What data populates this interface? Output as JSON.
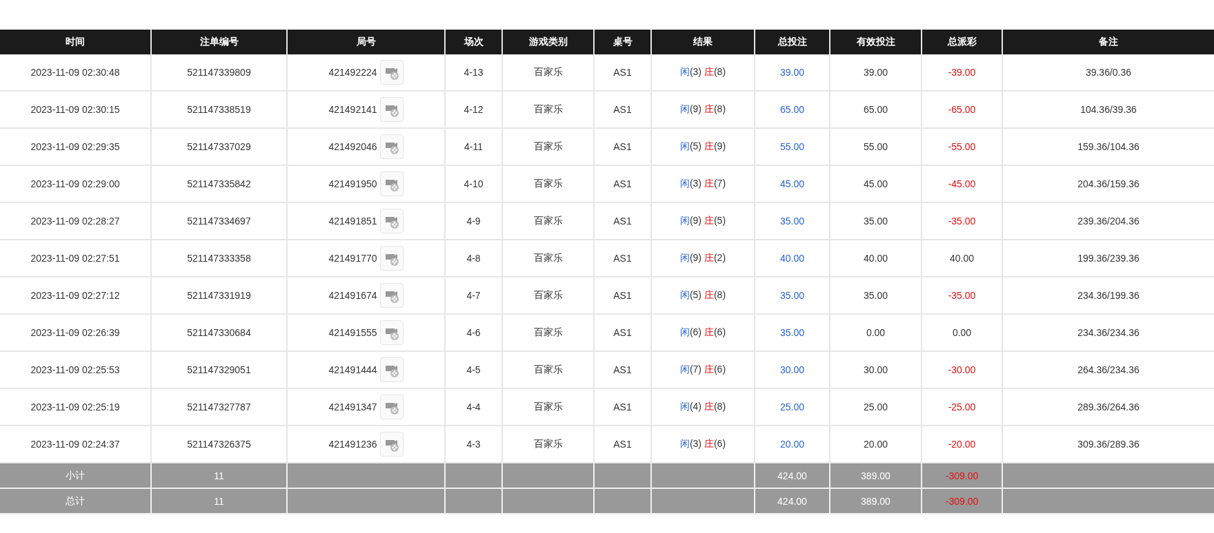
{
  "table": {
    "columns": [
      "时间",
      "注单编号",
      "局号",
      "场次",
      "游戏类别",
      "桌号",
      "结果",
      "总投注",
      "有效投注",
      "总派彩",
      "备注"
    ],
    "rows": [
      {
        "time": "2023-11-09 02:30:48",
        "bet_id": "521147339809",
        "round_id": "421492224",
        "shoe": "4-13",
        "game": "百家乐",
        "table": "AS1",
        "player": "闲",
        "player_points": "(3)",
        "banker": "庄",
        "banker_points": "(8)",
        "total_bet": "39.00",
        "valid_bet": "39.00",
        "payout": "-39.00",
        "payout_loss": true,
        "note": "39.36/0.36"
      },
      {
        "time": "2023-11-09 02:30:15",
        "bet_id": "521147338519",
        "round_id": "421492141",
        "shoe": "4-12",
        "game": "百家乐",
        "table": "AS1",
        "player": "闲",
        "player_points": "(9)",
        "banker": "庄",
        "banker_points": "(8)",
        "total_bet": "65.00",
        "valid_bet": "65.00",
        "payout": "-65.00",
        "payout_loss": true,
        "note": "104.36/39.36"
      },
      {
        "time": "2023-11-09 02:29:35",
        "bet_id": "521147337029",
        "round_id": "421492046",
        "shoe": "4-11",
        "game": "百家乐",
        "table": "AS1",
        "player": "闲",
        "player_points": "(5)",
        "banker": "庄",
        "banker_points": "(9)",
        "total_bet": "55.00",
        "valid_bet": "55.00",
        "payout": "-55.00",
        "payout_loss": true,
        "note": "159.36/104.36"
      },
      {
        "time": "2023-11-09 02:29:00",
        "bet_id": "521147335842",
        "round_id": "421491950",
        "shoe": "4-10",
        "game": "百家乐",
        "table": "AS1",
        "player": "闲",
        "player_points": "(3)",
        "banker": "庄",
        "banker_points": "(7)",
        "total_bet": "45.00",
        "valid_bet": "45.00",
        "payout": "-45.00",
        "payout_loss": true,
        "note": "204.36/159.36"
      },
      {
        "time": "2023-11-09 02:28:27",
        "bet_id": "521147334697",
        "round_id": "421491851",
        "shoe": "4-9",
        "game": "百家乐",
        "table": "AS1",
        "player": "闲",
        "player_points": "(9)",
        "banker": "庄",
        "banker_points": "(5)",
        "total_bet": "35.00",
        "valid_bet": "35.00",
        "payout": "-35.00",
        "payout_loss": true,
        "note": "239.36/204.36"
      },
      {
        "time": "2023-11-09 02:27:51",
        "bet_id": "521147333358",
        "round_id": "421491770",
        "shoe": "4-8",
        "game": "百家乐",
        "table": "AS1",
        "player": "闲",
        "player_points": "(9)",
        "banker": "庄",
        "banker_points": "(2)",
        "total_bet": "40.00",
        "valid_bet": "40.00",
        "payout": "40.00",
        "payout_loss": false,
        "note": "199.36/239.36"
      },
      {
        "time": "2023-11-09 02:27:12",
        "bet_id": "521147331919",
        "round_id": "421491674",
        "shoe": "4-7",
        "game": "百家乐",
        "table": "AS1",
        "player": "闲",
        "player_points": "(5)",
        "banker": "庄",
        "banker_points": "(8)",
        "total_bet": "35.00",
        "valid_bet": "35.00",
        "payout": "-35.00",
        "payout_loss": true,
        "note": "234.36/199.36"
      },
      {
        "time": "2023-11-09 02:26:39",
        "bet_id": "521147330684",
        "round_id": "421491555",
        "shoe": "4-6",
        "game": "百家乐",
        "table": "AS1",
        "player": "闲",
        "player_points": "(6)",
        "banker": "庄",
        "banker_points": "(6)",
        "total_bet": "35.00",
        "valid_bet": "0.00",
        "payout": "0.00",
        "payout_loss": false,
        "note": "234.36/234.36"
      },
      {
        "time": "2023-11-09 02:25:53",
        "bet_id": "521147329051",
        "round_id": "421491444",
        "shoe": "4-5",
        "game": "百家乐",
        "table": "AS1",
        "player": "闲",
        "player_points": "(7)",
        "banker": "庄",
        "banker_points": "(6)",
        "total_bet": "30.00",
        "valid_bet": "30.00",
        "payout": "-30.00",
        "payout_loss": true,
        "note": "264.36/234.36"
      },
      {
        "time": "2023-11-09 02:25:19",
        "bet_id": "521147327787",
        "round_id": "421491347",
        "shoe": "4-4",
        "game": "百家乐",
        "table": "AS1",
        "player": "闲",
        "player_points": "(4)",
        "banker": "庄",
        "banker_points": "(8)",
        "total_bet": "25.00",
        "valid_bet": "25.00",
        "payout": "-25.00",
        "payout_loss": true,
        "note": "289.36/264.36"
      },
      {
        "time": "2023-11-09 02:24:37",
        "bet_id": "521147326375",
        "round_id": "421491236",
        "shoe": "4-3",
        "game": "百家乐",
        "table": "AS1",
        "player": "闲",
        "player_points": "(3)",
        "banker": "庄",
        "banker_points": "(6)",
        "total_bet": "20.00",
        "valid_bet": "20.00",
        "payout": "-20.00",
        "payout_loss": true,
        "note": "309.36/289.36"
      }
    ],
    "totals": [
      {
        "label": "小计",
        "count": "11",
        "total_bet": "424.00",
        "valid_bet": "389.00",
        "payout": "-309.00",
        "payout_loss": true
      },
      {
        "label": "总计",
        "count": "11",
        "total_bet": "424.00",
        "valid_bet": "389.00",
        "payout": "-309.00",
        "payout_loss": true
      }
    ]
  }
}
